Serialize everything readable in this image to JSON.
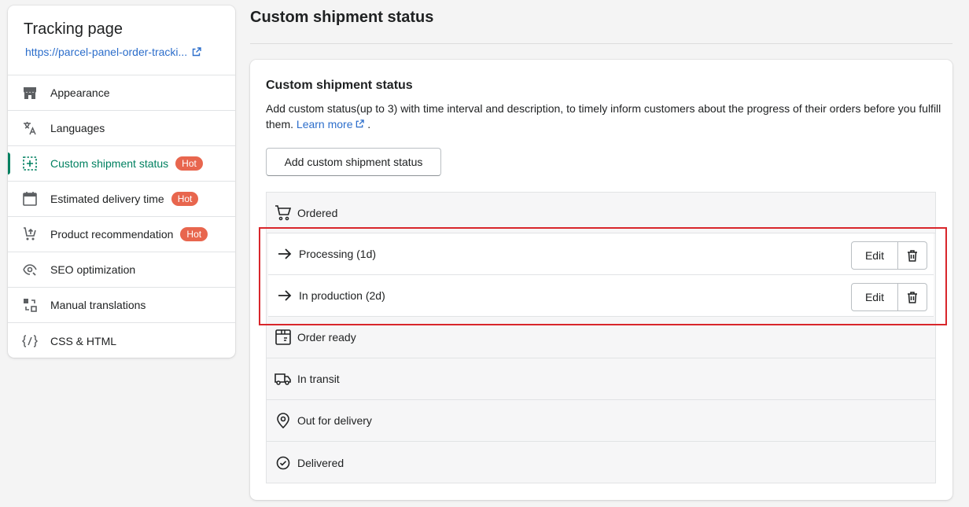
{
  "sidebar": {
    "title": "Tracking page",
    "link": "https://parcel-panel-order-tracki...",
    "items": [
      {
        "label": "Appearance",
        "icon": "store-icon",
        "hot": ""
      },
      {
        "label": "Languages",
        "icon": "translate-icon",
        "hot": ""
      },
      {
        "label": "Custom shipment status",
        "icon": "add-status-icon",
        "hot": "Hot",
        "active": true
      },
      {
        "label": "Estimated delivery time",
        "icon": "calendar-icon",
        "hot": "Hot"
      },
      {
        "label": "Product recommendation",
        "icon": "product-upload-icon",
        "hot": "Hot"
      },
      {
        "label": "SEO optimization",
        "icon": "seo-eye-icon",
        "hot": ""
      },
      {
        "label": "Manual translations",
        "icon": "translation-swap-icon",
        "hot": ""
      },
      {
        "label": "CSS & HTML",
        "icon": "code-icon",
        "hot": ""
      }
    ]
  },
  "main": {
    "page_title": "Custom shipment status",
    "card_title": "Custom shipment status",
    "description": "Add custom status(up to 3) with time interval and description, to timely inform customers about the progress of their orders before you fulfill them.",
    "learn_more": "Learn more",
    "description_end": ".",
    "add_button": "Add custom shipment status",
    "steps": [
      {
        "label": "Ordered",
        "icon": "cart-icon"
      },
      {
        "label": "Processing (1d)",
        "icon": "arrow-right-icon",
        "edit": "Edit"
      },
      {
        "label": "In production (2d)",
        "icon": "arrow-right-icon",
        "edit": "Edit"
      },
      {
        "label": "Order ready",
        "icon": "package-icon"
      },
      {
        "label": "In transit",
        "icon": "truck-icon"
      },
      {
        "label": "Out for delivery",
        "icon": "location-pin-icon"
      },
      {
        "label": "Delivered",
        "icon": "check-circle-icon"
      }
    ]
  },
  "colors": {
    "accent": "#008060",
    "link": "#2c6ecb",
    "hot_badge": "#e8664e",
    "highlight": "#d8262b"
  }
}
